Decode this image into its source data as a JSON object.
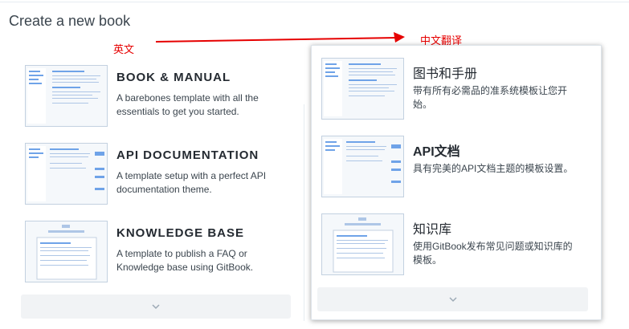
{
  "page": {
    "title": "Create a new book"
  },
  "annotations": {
    "english_label": "英文",
    "chinese_label": "中文翻译",
    "arrow_color": "#e60000"
  },
  "english": {
    "templates": [
      {
        "title": "BOOK & MANUAL",
        "description": "A barebones template with all the essentials to get you started.",
        "icon": "book-manual-thumbnail-icon"
      },
      {
        "title": "API DOCUMENTATION",
        "description": "A template setup with a perfect API documentation theme.",
        "icon": "api-documentation-thumbnail-icon"
      },
      {
        "title": "KNOWLEDGE BASE",
        "description": "A template to publish a FAQ or Knowledge base using GitBook.",
        "icon": "knowledge-base-thumbnail-icon"
      }
    ],
    "more_icon": "chevron-down-icon"
  },
  "chinese": {
    "templates": [
      {
        "title": "图书和手册",
        "description": "带有所有必需品的准系统模板让您开始。",
        "icon": "book-manual-thumbnail-icon"
      },
      {
        "title": "API文档",
        "description": "具有完美的API文档主题的模板设置。",
        "icon": "api-documentation-thumbnail-icon"
      },
      {
        "title": "知识库",
        "description": "使用GitBook发布常见问题或知识库的模板。",
        "icon": "knowledge-base-thumbnail-icon"
      }
    ],
    "more_icon": "chevron-down-icon"
  },
  "colors": {
    "thumb_accent": "#6fa3e8",
    "thumb_border": "#c3d1e0",
    "accent_red": "#e60000"
  }
}
